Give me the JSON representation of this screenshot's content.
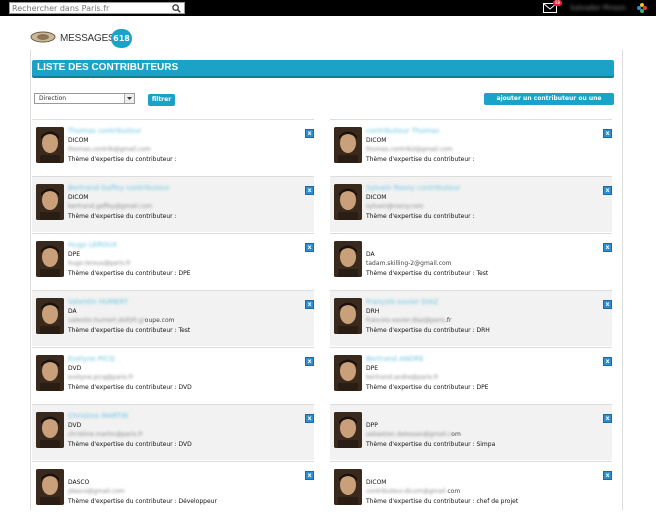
{
  "topbar": {
    "search_placeholder": "Rechercher dans Paris.fr",
    "mail_count": "88",
    "username": "Salvador Pinson"
  },
  "header": {
    "title": "MESSAGES",
    "count": "618"
  },
  "panel": {
    "heading": "LISTE DES CONTRIBUTEURS",
    "select_value": "Direction",
    "filter_button": "filtrer",
    "add_button": "ajouter un contributeur ou une direction",
    "delete_label": "x"
  },
  "contributors": [
    {
      "name": "Thomas contributeur",
      "dept": "DICOM",
      "email": "",
      "email_blur": "thomas.contrib@gmail.com",
      "theme": "Thème d'expertise du contributeur :"
    },
    {
      "name": "contributeur Thomas",
      "dept": "DICOM",
      "email": "",
      "email_blur": "thomas.contrib2@gmail.com",
      "theme": "Thème d'expertise du contributeur :"
    },
    {
      "name": "Bertrand Gaffey contributeur",
      "dept": "DICOM",
      "email": "",
      "email_blur": "bertrand.gaffey@gmail.com",
      "theme": "Thème d'expertise du contributeur :"
    },
    {
      "name": "Sylvain Rosny contributeur",
      "dept": "DICOM",
      "email": "",
      "email_blur": "sylvain@rosny.com",
      "theme": "Thème d'expertise du contributeur :"
    },
    {
      "name": "Hugo LEROUX",
      "dept": "DPE",
      "email": "",
      "email_blur": "hugo.leroux@paris.fr",
      "theme": "Thème d'expertise du contributeur : DPE"
    },
    {
      "name": "",
      "dept": "DA",
      "email": "tadam.skilling-2@gmail.com",
      "email_blur": "",
      "theme": "Thème d'expertise du contributeur : Test"
    },
    {
      "name": "Valentin HUMERT",
      "dept": "DA",
      "email": "oupe.com",
      "email_blur": "valentin.humert.skillsfr.gr",
      "theme": "Thème d'expertise du contributeur : Test"
    },
    {
      "name": "François-xavier DIAZ",
      "dept": "DRH",
      "email": ".fr",
      "email_blur": "francois-xavier.diaz@paris",
      "theme": "Thème d'expertise du contributeur : DRH"
    },
    {
      "name": "Evelyne PICQ",
      "dept": "DVD",
      "email": "",
      "email_blur": "evelyne.picq@paris.fr",
      "theme": "Thème d'expertise du contributeur : DVD"
    },
    {
      "name": "Bertrand ANDRE",
      "dept": "DPE",
      "email": "",
      "email_blur": "bertrand.andre@paris.fr",
      "theme": "Thème d'expertise du contributeur : DPE"
    },
    {
      "name": "Christine MARTIN",
      "dept": "DVD",
      "email": "",
      "email_blur": "christine.martin@paris.fr",
      "theme": "Thème d'expertise du contributeur : DVD"
    },
    {
      "name": "",
      "dept": "DPP",
      "email": "om",
      "email_blur": "sebastien.dalessan@gmail.c",
      "theme": "Thème d'expertise du contributeur : Simpa"
    },
    {
      "name": "",
      "dept": "DASCO",
      "email": "",
      "email_blur": "jdasco@gmail.com",
      "theme": "Thème d'expertise du contributeur : Développeur"
    },
    {
      "name": "",
      "dept": "DICOM",
      "email": "com",
      "email_blur": "contributeur.dicom@gmail.",
      "theme": "Thème d'expertise du contributeur : chef de projet"
    }
  ]
}
